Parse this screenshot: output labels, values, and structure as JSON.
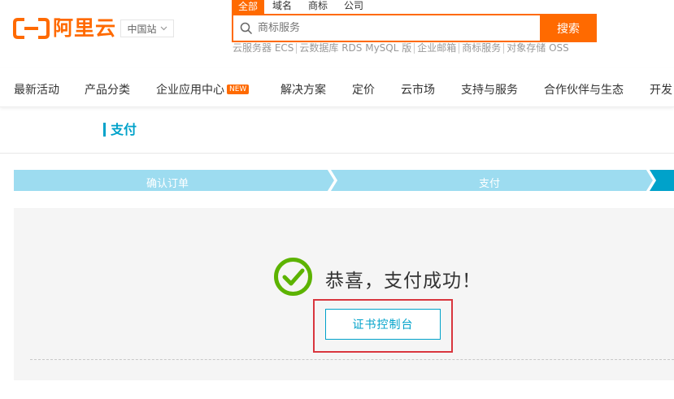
{
  "header": {
    "logo_text": "阿里云",
    "region_label": "中国站",
    "search": {
      "tabs": [
        {
          "label": "全部",
          "active": true
        },
        {
          "label": "域名",
          "active": false
        },
        {
          "label": "商标",
          "active": false
        },
        {
          "label": "公司",
          "active": false
        }
      ],
      "placeholder": "商标服务",
      "button_label": "搜索",
      "hot_words": [
        "云服务器 ECS",
        "云数据库 RDS MySQL 版",
        "企业邮箱",
        "商标服务",
        "对象存储 OSS"
      ]
    }
  },
  "nav": {
    "items": [
      {
        "label": "最新活动"
      },
      {
        "label": "产品分类"
      },
      {
        "label": "企业应用中心",
        "badge": "NEW"
      },
      {
        "label": "解决方案"
      },
      {
        "label": "定价"
      },
      {
        "label": "云市场"
      },
      {
        "label": "支持与服务"
      },
      {
        "label": "合作伙伴与生态"
      },
      {
        "label": "开发"
      }
    ]
  },
  "page": {
    "title": "支付"
  },
  "steps": [
    {
      "label": "确认订单"
    },
    {
      "label": "支付"
    }
  ],
  "result": {
    "message": "恭喜，支付成功！",
    "button_label": "证书控制台"
  },
  "colors": {
    "brand": "#ff6a00",
    "accent": "#00a2ca",
    "step_light": "#9ddcf0",
    "success": "#5cb300",
    "highlight": "#d9363e"
  }
}
